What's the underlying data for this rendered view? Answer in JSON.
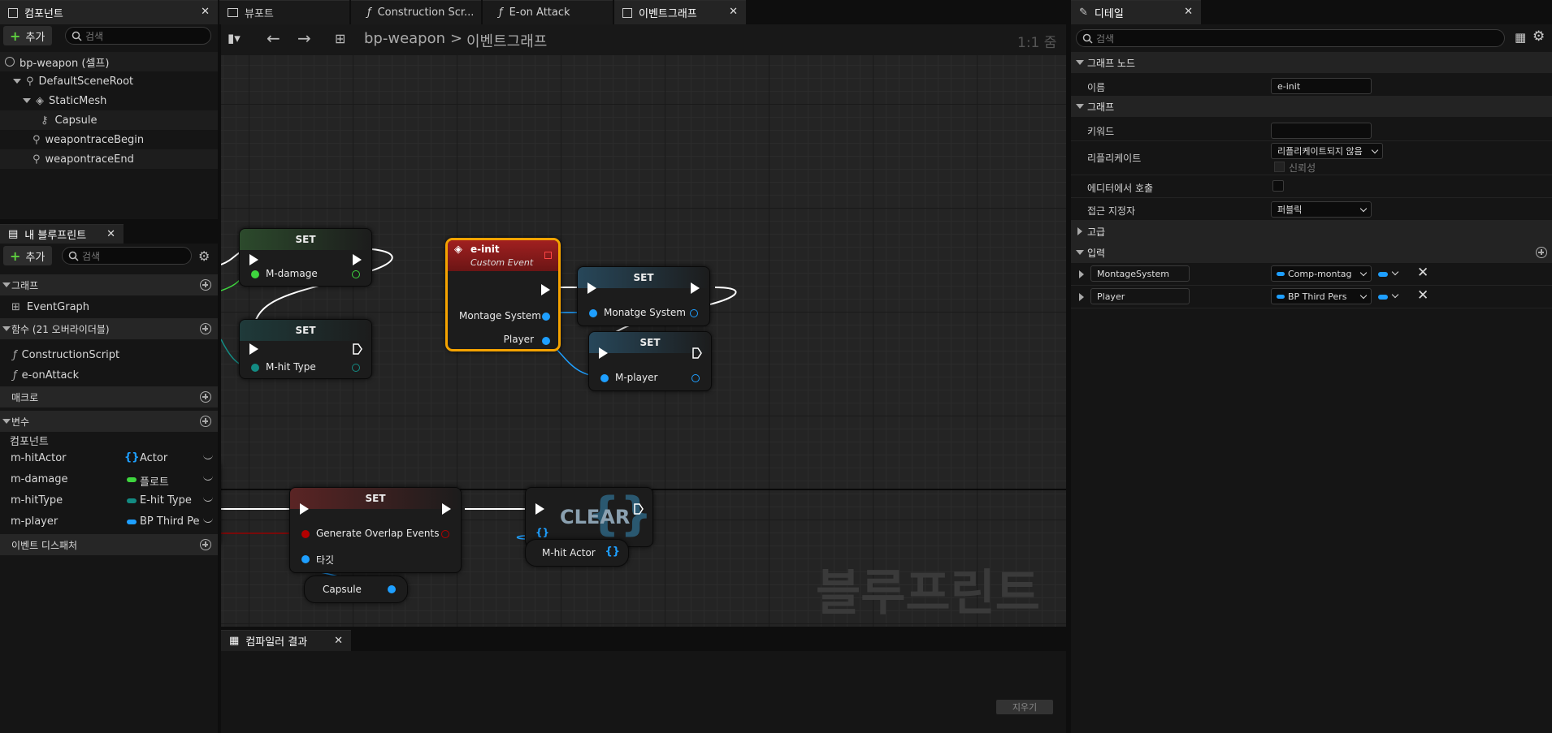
{
  "tabs": {
    "components": "컴포넌트",
    "viewport": "뷰포트",
    "construction": "Construction Scr...",
    "onattack": "E-on Attack",
    "eventgraph": "이벤트그래프",
    "details": "디테일"
  },
  "components_panel": {
    "add": "추가",
    "search_placeholder": "검색",
    "items": [
      {
        "label": "bp-weapon (셀프)"
      },
      {
        "label": "DefaultSceneRoot"
      },
      {
        "label": "StaticMesh"
      },
      {
        "label": "Capsule"
      },
      {
        "label": "weapontraceBegin"
      },
      {
        "label": "weapontraceEnd"
      }
    ]
  },
  "myblueprint": {
    "title": "내 블루프린트",
    "add": "추가",
    "search_placeholder": "검색",
    "sections": {
      "graph": "그래프",
      "functions": "함수 (21 오버라이더블)",
      "macros": "매크로",
      "variables": "변수",
      "dispatchers": "이벤트 디스패처"
    },
    "graphs": [
      "EventGraph"
    ],
    "functions": [
      "ConstructionScript",
      "e-onAttack"
    ],
    "variables_category": "컴포넌트",
    "variables": [
      {
        "name": "m-hitActor",
        "type": "Actor",
        "color": "#1e9fff"
      },
      {
        "name": "m-damage",
        "type": "플로트",
        "color": "#3ed63e"
      },
      {
        "name": "m-hitType",
        "type": "E-hit Type",
        "color": "#138b83"
      },
      {
        "name": "m-player",
        "type": "BP Third Pe",
        "color": "#1e9fff"
      }
    ]
  },
  "graph_toolbar": {
    "breadcrumb_root": "bp-weapon",
    "breadcrumb_sep": ">",
    "breadcrumb_current": "이벤트그래프",
    "zoom": "1:1 줌"
  },
  "nodes": {
    "set1": {
      "title": "SET",
      "pin": "M-damage"
    },
    "set2": {
      "title": "SET",
      "pin": "M-hit Type"
    },
    "einit": {
      "title": "e-init",
      "subtitle": "Custom Event",
      "pin1": "Montage System",
      "pin2": "Player"
    },
    "set3": {
      "title": "SET",
      "pin": "Monatge System"
    },
    "set4": {
      "title": "SET",
      "pin": "M-player"
    },
    "set5": {
      "title": "SET",
      "pin1": "Generate Overlap Events",
      "pin2": "타깃"
    },
    "capsule": {
      "label": "Capsule"
    },
    "clear": {
      "title": "CLEAR"
    },
    "mhitactor": {
      "label": "M-hit Actor"
    }
  },
  "watermark": "블루프린트",
  "compiler": {
    "title": "컴파일러 결과",
    "clear": "지우기"
  },
  "details": {
    "search_placeholder": "검색",
    "sections": {
      "graph_node": "그래프 노드",
      "graph": "그래프",
      "advanced": "고급",
      "inputs": "입력"
    },
    "name_label": "이름",
    "name_value": "e-init",
    "keyword_label": "키워드",
    "keyword_value": "",
    "replicate_label": "리플리케이트",
    "replicate_value": "리플리케이트되지 않음",
    "reliable_label": "신뢰성",
    "call_in_editor_label": "에디터에서 호출",
    "access_label": "접근 지정자",
    "access_value": "퍼블릭",
    "inputs": [
      {
        "name": "MontageSystem",
        "type": "Comp-montag"
      },
      {
        "name": "Player",
        "type": "BP Third Pers"
      }
    ]
  },
  "colors": {
    "exec": "#ffffff",
    "object_pin": "#1e9fff",
    "float_pin": "#3ed63e",
    "enum_pin": "#138b83",
    "bool_pin": "#930000",
    "event_header": "#8e1c1c",
    "set_header_green": "#2c4a2c",
    "set_header_blue": "#27475a",
    "set_header_red": "#5a2424",
    "selection": "#f5a300"
  }
}
